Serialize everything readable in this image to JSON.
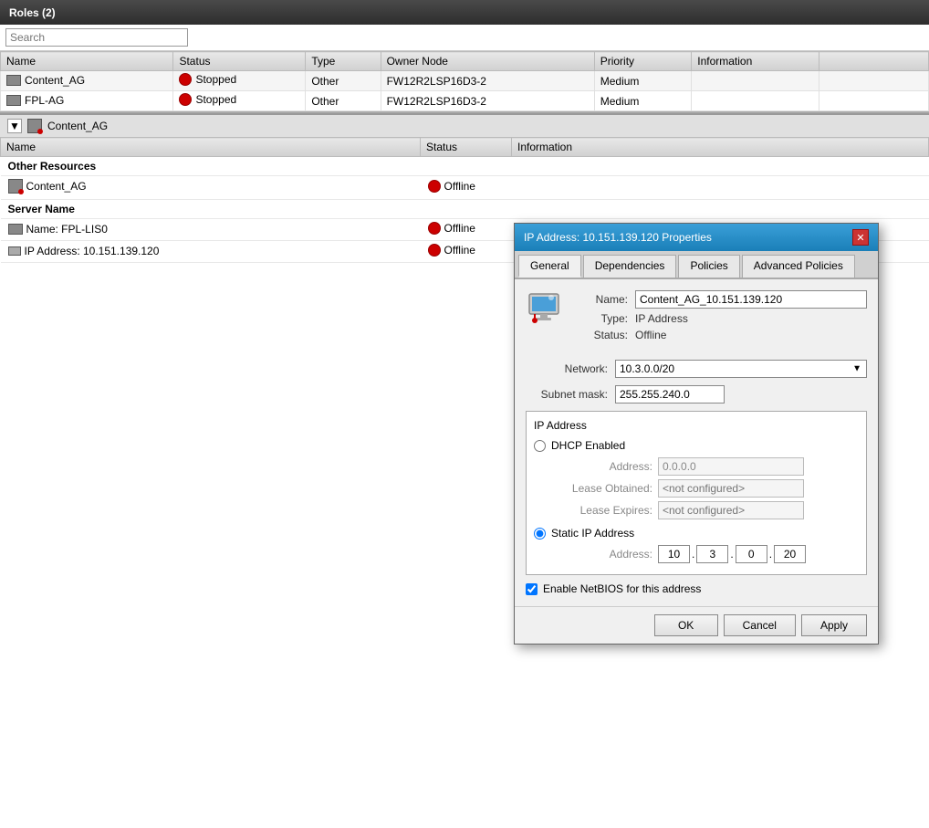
{
  "title_bar": {
    "label": "Roles (2)"
  },
  "search": {
    "placeholder": "Search"
  },
  "table": {
    "columns": [
      "Name",
      "Status",
      "Type",
      "Owner Node",
      "Priority",
      "Information"
    ],
    "rows": [
      {
        "name": "Content_AG",
        "status": "Stopped",
        "type": "Other",
        "owner_node": "FW12R2LSP16D3-2",
        "priority": "Medium",
        "info": ""
      },
      {
        "name": "FPL-AG",
        "status": "Stopped",
        "type": "Other",
        "owner_node": "FW12R2LSP16D3-2",
        "priority": "Medium",
        "info": ""
      }
    ]
  },
  "bottom_section": {
    "title": "Content_AG",
    "table": {
      "columns": [
        "Name",
        "Status",
        "Information"
      ],
      "sections": [
        {
          "header": "Other Resources",
          "items": [
            {
              "name": "Content_AG",
              "status": "Offline",
              "indent": 1
            }
          ]
        },
        {
          "header": "Server Name",
          "items": [
            {
              "name": "Name: FPL-LIS0",
              "status": "Offline",
              "indent": 1
            },
            {
              "name": "IP Address: 10.151.139.120",
              "status": "Offline",
              "indent": 2
            }
          ]
        }
      ]
    }
  },
  "dialog": {
    "title": "IP Address: 10.151.139.120 Properties",
    "tabs": [
      "General",
      "Dependencies",
      "Policies",
      "Advanced Policies"
    ],
    "active_tab": "General",
    "name_field": "Content_AG_10.151.139.120",
    "type_field": "IP Address",
    "status_field": "Offline",
    "network_label": "Network:",
    "network_value": "10.3.0.0/20",
    "subnet_label": "Subnet mask:",
    "subnet_value": "255.255.240.0",
    "ip_section_title": "IP Address",
    "dhcp_label": "DHCP Enabled",
    "dhcp_address_label": "Address:",
    "dhcp_address_value": "0.0.0.0",
    "lease_obtained_label": "Lease Obtained:",
    "lease_obtained_value": "<not configured>",
    "lease_expires_label": "Lease Expires:",
    "lease_expires_value": "<not configured>",
    "static_ip_label": "Static IP Address",
    "static_address_label": "Address:",
    "ip_seg1": "10",
    "ip_seg2": "3",
    "ip_seg3": "0",
    "ip_seg4": "20",
    "netbios_label": "Enable NetBIOS for this address",
    "buttons": {
      "ok": "OK",
      "cancel": "Cancel",
      "apply": "Apply"
    }
  }
}
